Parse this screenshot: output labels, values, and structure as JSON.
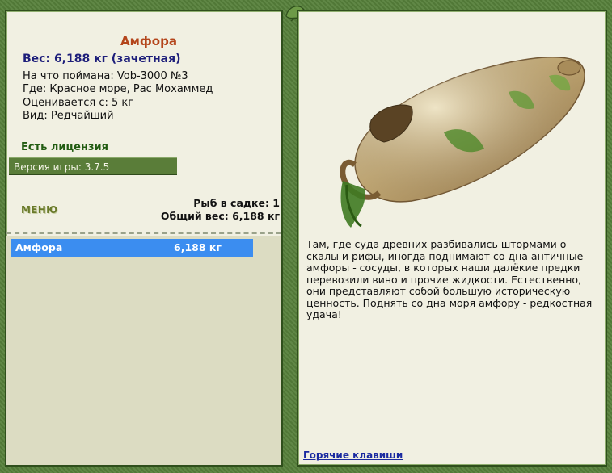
{
  "fish": {
    "title": "Амфора",
    "weight_line": "Вес: 6,188 кг (зачетная)",
    "caught_on": "На что поймана: Vob-3000 №3",
    "where": "Где: Красное море, Рас Мохаммед",
    "rated": "Оценивается с: 5 кг",
    "kind": "Вид: Редчайший"
  },
  "license": {
    "label": "Есть лицензия"
  },
  "version": {
    "label": "Версия игры: 3.7.5"
  },
  "menu": {
    "label": "МЕНЮ"
  },
  "stats": {
    "fish_in_keepnet": "Рыб в садке: 1",
    "total_weight": "Общий вес: 6,188 кг"
  },
  "catch_list": [
    {
      "name": "Амфора",
      "weight": "6,188 кг"
    }
  ],
  "description": "Там, где суда древних разбивались штормами о скалы и рифы, иногда поднимают со дна античные амфоры - сосуды, в которых наши далёкие предки перевозили вино и прочие жидкости. Естественно, они представляют собой большую историческую ценность. Поднять со дна моря амфору - редкостная удача!",
  "hotkeys": {
    "label": "Горячие клавиши"
  },
  "colors": {
    "frame": "#56803a",
    "panel": "#f1f0e2",
    "title": "#b4451b",
    "weight": "#1d1e7a",
    "selected_row": "#3b8df0",
    "link": "#1a2aa0"
  }
}
